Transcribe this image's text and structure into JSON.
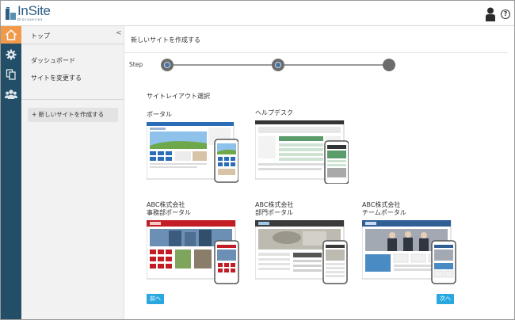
{
  "header": {
    "logo_name": "InSite",
    "logo_sub": "Discoveries"
  },
  "rail": {
    "icons": [
      "home-icon",
      "gear-icon",
      "copy-icon",
      "users-icon"
    ]
  },
  "sidebar": {
    "top_label": "トップ",
    "collapse": "<",
    "items": [
      {
        "label": "ダッシュボード"
      },
      {
        "label": "サイトを変更する"
      }
    ],
    "new_site": "+ 新しいサイトを作成する"
  },
  "main": {
    "title": "新しいサイトを作成する",
    "step_label": "Step",
    "steps_total": 3,
    "steps_completed": 2,
    "section_title": "サイトレイアウト選択",
    "layouts": [
      {
        "name": "ポータル"
      },
      {
        "name": "ヘルプデスク"
      },
      {
        "name": "ABC株式会社\n事務部ポータル"
      },
      {
        "name": "ABC株式会社\n部門ポータル"
      },
      {
        "name": "ABC株式会社\nチームポータル"
      }
    ],
    "prev_button": "前へ",
    "next_button": "次へ"
  },
  "colors": {
    "accent": "#f19a4b",
    "rail": "#234e67",
    "button": "#29a8e0"
  }
}
